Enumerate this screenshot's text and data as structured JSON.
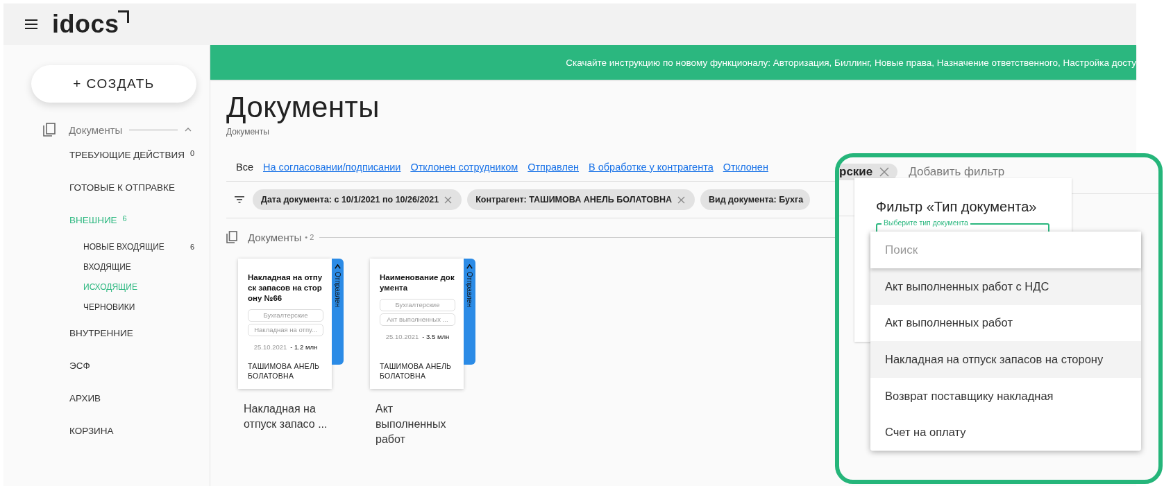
{
  "header": {
    "logo": "idocs"
  },
  "sidebar": {
    "create_button": "+ СОЗДАТЬ",
    "section": {
      "label": "Документы",
      "expanded": true
    },
    "items": [
      {
        "label": "ТРЕБУЮЩИЕ ДЕЙСТВИЯ",
        "count": "0",
        "selected": false
      },
      {
        "label": "ГОТОВЫЕ К ОТПРАВКЕ",
        "selected": false
      },
      {
        "label": "ВНЕШНИЕ",
        "count": "6",
        "selected": true,
        "children": [
          {
            "label": "НОВЫЕ ВХОДЯЩИЕ",
            "count": "6",
            "selected": false
          },
          {
            "label": "ВХОДЯЩИЕ",
            "selected": false
          },
          {
            "label": "ИСХОДЯЩИЕ",
            "selected": true
          },
          {
            "label": "ЧЕРНОВИКИ",
            "selected": false
          }
        ]
      },
      {
        "label": "ВНУТРЕННИЕ",
        "selected": false
      },
      {
        "label": "ЭСФ",
        "selected": false
      },
      {
        "label": "АРХИВ",
        "selected": false
      },
      {
        "label": "КОРЗИНА",
        "selected": false
      }
    ]
  },
  "banner": {
    "text": "Скачайте инструкцию по новому функционалу: Авторизация, Биллинг, Новые права, Назначение ответственного, Настройка досту"
  },
  "page": {
    "title": "Документы",
    "breadcrumb": "Документы"
  },
  "status_tabs": [
    {
      "label": "Все",
      "selected": true
    },
    {
      "label": "На согласовании/подписании",
      "selected": false
    },
    {
      "label": "Отклонен сотрудником",
      "selected": false
    },
    {
      "label": "Отправлен",
      "selected": false
    },
    {
      "label": "В обработке у контрагента",
      "selected": false
    },
    {
      "label": "Отклонен",
      "selected": false
    }
  ],
  "filters": [
    {
      "text": "Дата документа: с 10/1/2021 по 10/26/2021",
      "closable": true
    },
    {
      "text": "Контрагент: **ТАШИМОВА АНЕЛЬ БОЛАТОВНА**",
      "closable": true
    },
    {
      "text": "Вид документа: Бухга",
      "closable": false
    }
  ],
  "documents": {
    "label": "Документы",
    "count": "• 2",
    "cards": [
      {
        "title": "Накладная на отпуск запасов на сторону №66",
        "status": "Отправлен",
        "tags": [
          "Бухгалтерские",
          "Накладная на отпу..."
        ],
        "date": "25.10.2021",
        "amount": "- 1.2 млн",
        "counterparty": "ТАШИМОВА АНЕЛЬ БОЛАТОВНА",
        "caption": "Накладная на отпуск запасо ..."
      },
      {
        "title": "Наименование документа",
        "status": "Отправлен",
        "tags": [
          "Бухгалтерские",
          "Акт выполненных ..."
        ],
        "date": "25.10.2021",
        "amount": "- 3.5 млн",
        "counterparty": "ТАШИМОВА АНЕЛЬ БОЛАТОВНА",
        "caption": "Акт выполненных работ"
      }
    ]
  },
  "callout": {
    "chip": "рские",
    "add_filter": "Добавить фильтр",
    "panel": {
      "title": "Фильтр «Тип документа»",
      "field_label": "Выберите тип документа"
    },
    "dropdown": {
      "placeholder": "Поиск",
      "options": [
        {
          "label": "Акт выполненных работ с НДС",
          "selected": true
        },
        {
          "label": "Акт выполненных работ",
          "selected": false
        },
        {
          "label": "Накладная на отпуск запасов на сторону",
          "selected": true
        },
        {
          "label": "Возврат поставщику накладная",
          "selected": false
        },
        {
          "label": "Счет на оплату",
          "selected": false
        }
      ]
    }
  }
}
